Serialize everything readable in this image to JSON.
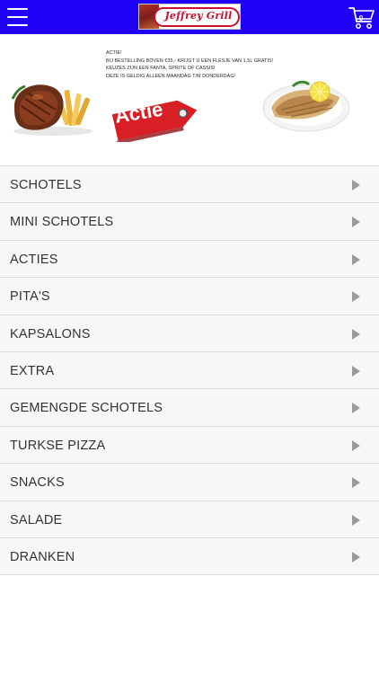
{
  "header": {
    "background_color": "#1f00f5",
    "menu_icon": "hamburger-menu-icon",
    "logo": {
      "text": "Jeffrey Grill",
      "color": "#c8102e"
    },
    "cart": {
      "icon": "shopping-cart-icon",
      "count": "0"
    }
  },
  "banner": {
    "lines": [
      "ACTIE!",
      "BIJ BESTELLING BOVEN €35,- KRIJGT U EEN FLESJE VAN 1,5L GRATIS!",
      "KEUZES ZIJN EEN FANTA, SPRITE OF CASSIS!",
      "DEZE IS GELDIG ALLEEN MAANDAG T/M DONDERDAG!"
    ],
    "tag_label": "Actie",
    "tag_color": "#d81f26",
    "left_image": "steak-with-fries-photo",
    "right_image": "wrap-with-lemon-photo"
  },
  "menu": {
    "chevron_icon": "chevron-right-icon",
    "items": [
      {
        "label": "SCHOTELS"
      },
      {
        "label": "MINI SCHOTELS"
      },
      {
        "label": "ACTIES"
      },
      {
        "label": "PITA'S"
      },
      {
        "label": "KAPSALONS"
      },
      {
        "label": "EXTRA"
      },
      {
        "label": "GEMENGDE SCHOTELS"
      },
      {
        "label": "TURKSE PIZZA"
      },
      {
        "label": "SNACKS"
      },
      {
        "label": "SALADE"
      },
      {
        "label": "DRANKEN"
      }
    ]
  }
}
